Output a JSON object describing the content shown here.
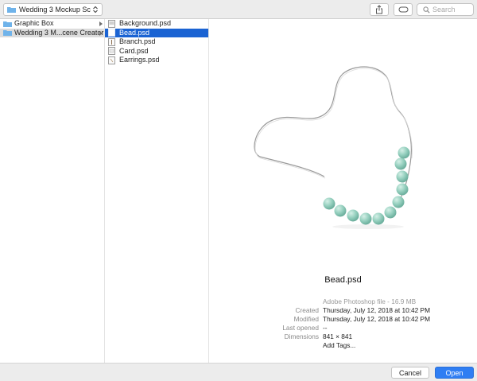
{
  "toolbar": {
    "location": "Wedding 3 Mockup Sce...",
    "search_placeholder": "Search",
    "icons": {
      "share": "share-icon",
      "tag": "tag-icon",
      "search": "search-icon",
      "folder": "folder-icon",
      "popup": "chevron-updown-icon"
    }
  },
  "column1": {
    "items": [
      {
        "name": "Graphic Box",
        "kind": "folder",
        "has_children": true
      },
      {
        "name": "Wedding 3 M...cene Creator",
        "kind": "folder",
        "has_children": true,
        "state": "parent-selected"
      }
    ]
  },
  "column2": {
    "items": [
      {
        "name": "Background.psd",
        "kind": "psd"
      },
      {
        "name": "Bead.psd",
        "kind": "psd",
        "state": "selected"
      },
      {
        "name": "Branch.psd",
        "kind": "psd"
      },
      {
        "name": "Card.psd",
        "kind": "psd"
      },
      {
        "name": "Earrings.psd",
        "kind": "psd"
      }
    ]
  },
  "preview": {
    "file_name": "Bead.psd",
    "kind_size": "Adobe Photoshop file - 16.9 MB",
    "created_label": "Created",
    "created_value": "Thursday, July 12, 2018 at 10:42 PM",
    "modified_label": "Modified",
    "modified_value": "Thursday, July 12, 2018 at 10:42 PM",
    "last_opened_label": "Last opened",
    "last_opened_value": "--",
    "dimensions_label": "Dimensions",
    "dimensions_value": "841 × 841",
    "add_tags": "Add Tags..."
  },
  "footer": {
    "cancel": "Cancel",
    "open": "Open"
  },
  "colors": {
    "selection": "#1a63d3",
    "primary_button": "#2f7ef3",
    "link": "#2a6fd6",
    "folder": "#6fb3ea",
    "bead": "#96d0bf"
  }
}
